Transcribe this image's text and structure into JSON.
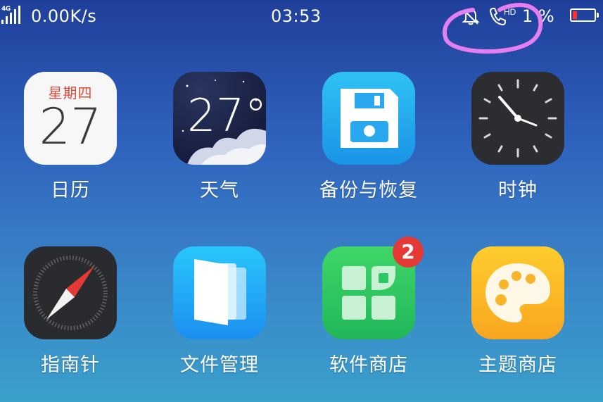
{
  "status_bar": {
    "network_type": "4G",
    "data_speed": "0.00K/s",
    "time": "03:53",
    "hd_label": "HD",
    "battery_percent": "1 %",
    "battery_level": 0.01,
    "icons": [
      "signal-icon",
      "bell-muted-icon",
      "hd-call-icon",
      "battery-icon"
    ]
  },
  "apps": [
    {
      "name": "日历",
      "icon": "calendar-icon",
      "weekday": "星期四",
      "day": "27"
    },
    {
      "name": "天气",
      "icon": "weather-icon",
      "temperature": "27°"
    },
    {
      "name": "备份与恢复",
      "icon": "floppy-disk-icon"
    },
    {
      "name": "时钟",
      "icon": "clock-icon"
    },
    {
      "name": "指南针",
      "icon": "compass-icon"
    },
    {
      "name": "文件管理",
      "icon": "files-icon"
    },
    {
      "name": "软件商店",
      "icon": "app-store-icon",
      "badge": "2"
    },
    {
      "name": "主题商店",
      "icon": "palette-icon"
    }
  ],
  "colors": {
    "background_top": "#1f3f9a",
    "background_bottom": "#3aa0cc",
    "annotation_circle": "#e57ef0",
    "badge": "#e53935",
    "battery_low": "#ff3030"
  }
}
